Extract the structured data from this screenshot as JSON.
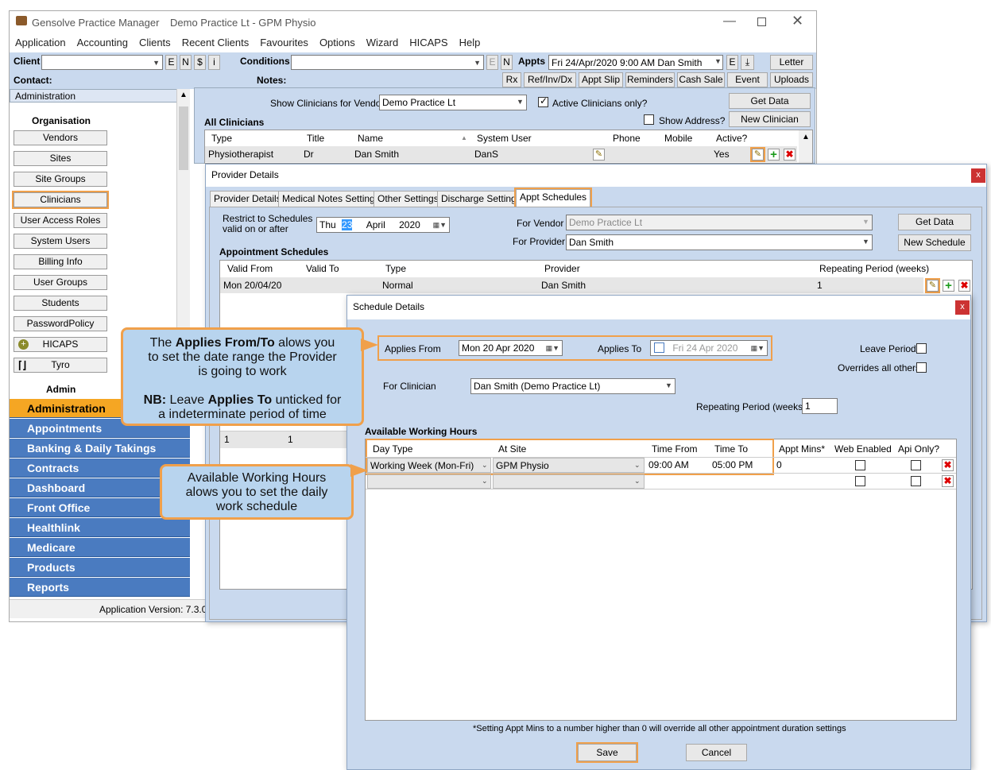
{
  "app": {
    "title": "Gensolve Practice Manager",
    "subtitle": "Demo Practice Lt - GPM Physio"
  },
  "menu": [
    "Application",
    "Accounting",
    "Clients",
    "Recent Clients",
    "Favourites",
    "Options",
    "Wizard",
    "HICAPS",
    "Help"
  ],
  "toolbar": {
    "client_label": "Client",
    "conditions_label": "Conditions",
    "appts_label": "Appts",
    "appts_value": "Fri 24/Apr/2020 9:00 AM Dan Smith",
    "contact_label": "Contact:",
    "notes_label": "Notes:",
    "e": "E",
    "n": "N",
    "dollar": "$",
    "i": "i",
    "letter": "Letter",
    "rx": "Rx",
    "ref": "Ref/Inv/Dx",
    "apptslip": "Appt Slip",
    "reminders": "Reminders",
    "cashsale": "Cash Sale",
    "event": "Event",
    "uploads": "Uploads"
  },
  "sidebar": {
    "header": "Administration",
    "section_org": "Organisation",
    "section_admin": "Admin",
    "items": [
      "Vendors",
      "Sites",
      "Site Groups",
      "Clinicians",
      "User Access Roles",
      "System Users",
      "Billing Info",
      "User Groups",
      "Students",
      "PasswordPolicy",
      "HICAPS",
      "Tyro"
    ],
    "nav": [
      "Administration",
      "Appointments",
      "Banking & Daily Takings",
      "Contracts",
      "Dashboard",
      "Front Office",
      "Healthlink",
      "Medicare",
      "Products",
      "Reports"
    ],
    "version": "Application Version: 7.3.0.16"
  },
  "clinicians": {
    "vendor_label": "Show Clinicians for Vendor",
    "vendor_value": "Demo Practice Lt",
    "active_only": "Active Clinicians only?",
    "get_data": "Get Data",
    "show_address": "Show Address?",
    "new_clinician": "New Clinician",
    "title": "All Clinicians",
    "columns": [
      "Type",
      "Title",
      "Name",
      "System User",
      "Phone",
      "Mobile",
      "Active?"
    ],
    "row": [
      "Physiotherapist",
      "Dr",
      "Dan Smith",
      "DanS",
      "",
      "",
      "Yes"
    ]
  },
  "provider": {
    "title": "Provider Details",
    "tabs": [
      "Provider Details",
      "Medical Notes Settings",
      "Other Settings",
      "Discharge Settings",
      "Appt Schedules"
    ],
    "restrict_label1": "Restrict to Schedules",
    "restrict_label2": "valid on or after",
    "restrict_day": "Thu",
    "restrict_date": "23",
    "restrict_month": "April",
    "restrict_year": "2020",
    "for_vendor": "For Vendor",
    "vendor_value": "Demo Practice Lt",
    "for_provider": "For Provider",
    "provider_value": "Dan Smith",
    "get_data": "Get Data",
    "new_schedule": "New Schedule",
    "appt_schedules": "Appointment Schedules",
    "columns": [
      "Valid From",
      "Valid To",
      "Type",
      "Provider",
      "Repeating Period (weeks)"
    ],
    "row": [
      "Mon 20/04/20",
      "",
      "Normal",
      "Dan Smith",
      "1"
    ],
    "bg_row": [
      "1",
      "1"
    ]
  },
  "schedule": {
    "title": "Schedule Details",
    "applies_from": "Applies From",
    "applies_from_value": "Mon 20 Apr 2020",
    "applies_to": "Applies To",
    "applies_to_value": "Fri  24  Apr  2020",
    "leave_period": "Leave Period",
    "overrides": "Overrides all others",
    "for_clinician": "For Clinician",
    "clinician_value": "Dan Smith (Demo Practice Lt)",
    "repeating": "Repeating Period (weeks)",
    "repeating_value": "1",
    "hours_title": "Available Working Hours",
    "columns": [
      "Day Type",
      "At Site",
      "Time From",
      "Time To",
      "Appt Mins*",
      "Web Enabled",
      "Api Only?"
    ],
    "row": [
      "Working Week (Mon-Fri)",
      "GPM Physio",
      "09:00 AM",
      "05:00 PM",
      "0"
    ],
    "footnote": "*Setting Appt Mins to a number higher than 0 will override all other appointment duration settings",
    "save": "Save",
    "cancel": "Cancel",
    "close": "x"
  },
  "callouts": {
    "c1_line1_a": "The ",
    "c1_line1_b": "Applies From/To",
    "c1_line1_c": " alows you",
    "c1_line2": "to set the date range the Provider",
    "c1_line3": "is going to work",
    "c1_line4_a": "NB:",
    "c1_line4_b": " Leave ",
    "c1_line4_c": "Applies To",
    "c1_line4_d": " unticked for",
    "c1_line5": "a indeterminate period of time",
    "c2_line1": "Available Working Hours",
    "c2_line2": "alows you to set the daily",
    "c2_line3": "work schedule"
  }
}
